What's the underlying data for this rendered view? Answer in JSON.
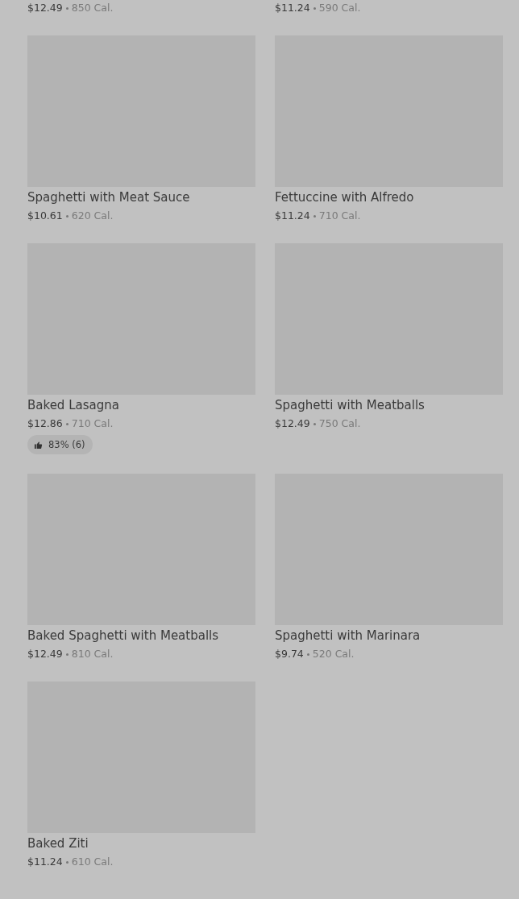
{
  "partial_row": [
    {
      "price": "$12.49",
      "calories": "850 Cal."
    },
    {
      "price": "$11.24",
      "calories": "590 Cal."
    }
  ],
  "items": [
    {
      "name": "Spaghetti with Meat Sauce",
      "price": "$10.61",
      "calories": "620 Cal."
    },
    {
      "name": "Fettuccine with Alfredo",
      "price": "$11.24",
      "calories": "710 Cal."
    },
    {
      "name": "Baked Lasagna",
      "price": "$12.86",
      "calories": "710 Cal.",
      "rating": "83% (6)"
    },
    {
      "name": "Spaghetti with Meatballs",
      "price": "$12.49",
      "calories": "750 Cal."
    },
    {
      "name": "Baked Spaghetti with Meatballs",
      "price": "$12.49",
      "calories": "810 Cal."
    },
    {
      "name": "Spaghetti with Marinara",
      "price": "$9.74",
      "calories": "520 Cal."
    },
    {
      "name": "Baked Ziti",
      "price": "$11.24",
      "calories": "610 Cal."
    }
  ]
}
